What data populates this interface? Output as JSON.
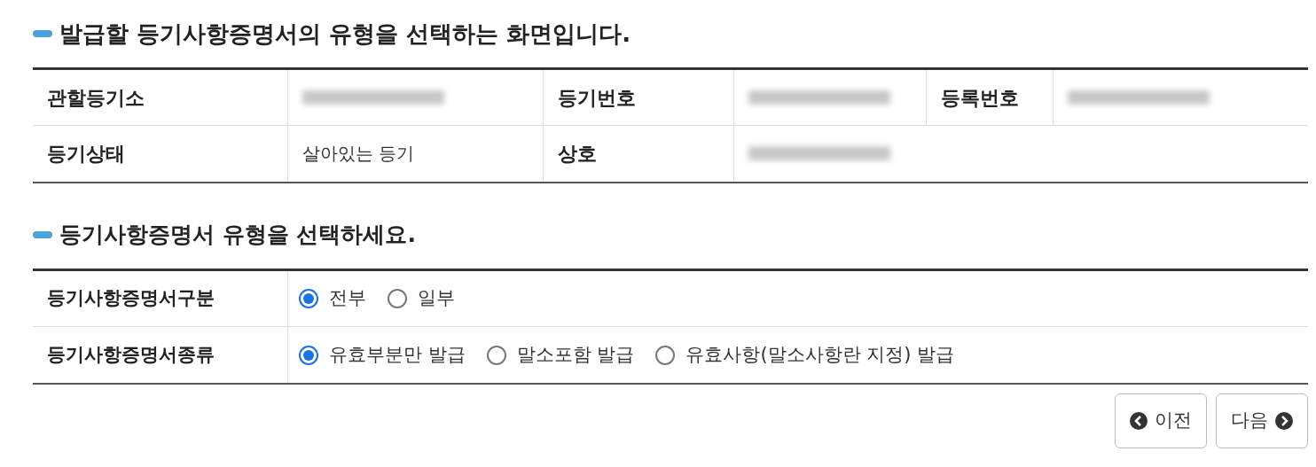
{
  "title": "발급할 등기사항증명서의 유형을 선택하는 화면입니다.",
  "info_table": {
    "rows": [
      {
        "cells": [
          {
            "kind": "label",
            "text": "관할등기소"
          },
          {
            "kind": "redacted"
          },
          {
            "kind": "label",
            "text": "등기번호"
          },
          {
            "kind": "redacted"
          },
          {
            "kind": "label",
            "text": "등록번호"
          },
          {
            "kind": "redacted"
          }
        ]
      },
      {
        "cells": [
          {
            "kind": "label",
            "text": "등기상태"
          },
          {
            "kind": "value",
            "text": "살아있는 등기"
          },
          {
            "kind": "label",
            "text": "상호"
          },
          {
            "kind": "redacted"
          }
        ]
      }
    ]
  },
  "section_title": "등기사항증명서 유형을 선택하세요.",
  "options_table": [
    {
      "label": "등기사항증명서구분",
      "options": [
        {
          "text": "전부",
          "selected": true
        },
        {
          "text": "일부",
          "selected": false
        }
      ]
    },
    {
      "label": "등기사항증명서종류",
      "options": [
        {
          "text": "유효부분만 발급",
          "selected": true
        },
        {
          "text": "말소포함 발급",
          "selected": false
        },
        {
          "text": "유효사항(말소사항란 지정) 발급",
          "selected": false
        }
      ]
    }
  ],
  "buttons": [
    {
      "kind": "prev",
      "text": "이전"
    },
    {
      "kind": "next",
      "text": "다음"
    }
  ]
}
